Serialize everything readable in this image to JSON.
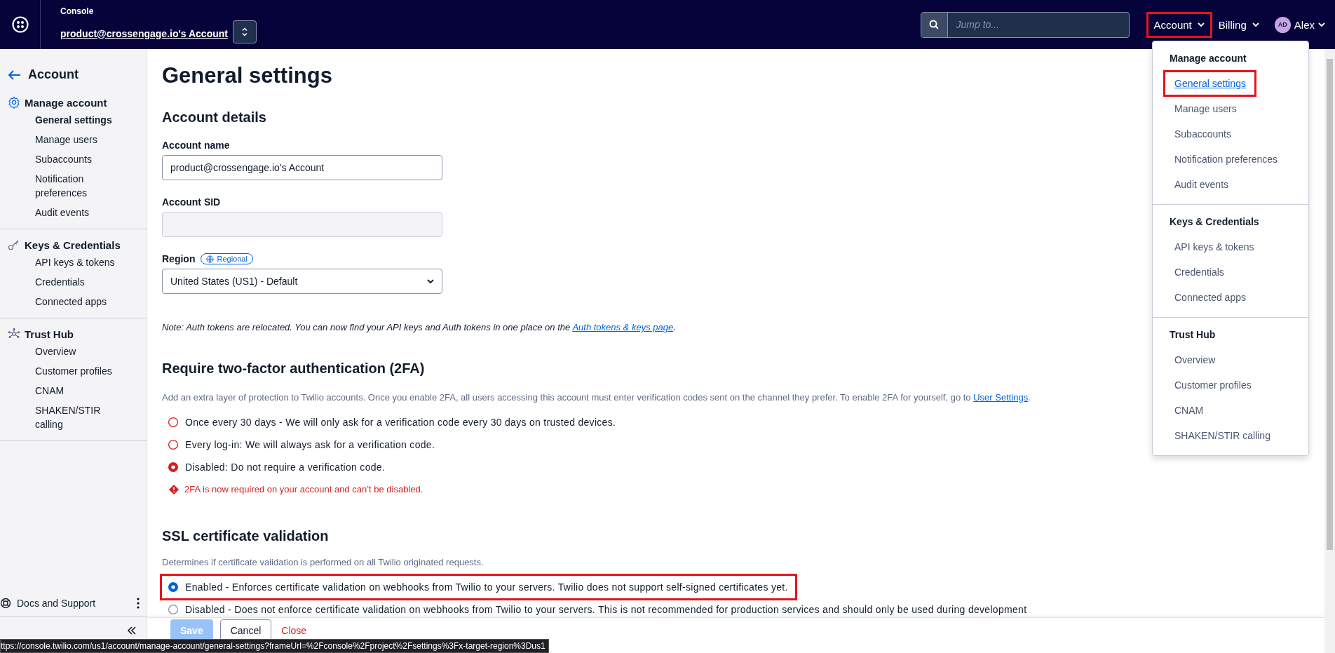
{
  "topbar": {
    "product": "Console",
    "account_name": "product@crossengage.io's Account",
    "search": {
      "placeholder": "Jump to..."
    },
    "nav": [
      {
        "label": "Account",
        "highlighted": true
      },
      {
        "label": "Billing",
        "highlighted": false
      }
    ],
    "user": {
      "initials": "AD",
      "name": "Alex"
    }
  },
  "sidebar": {
    "back_label": "Account",
    "sections": [
      {
        "kind": "gear",
        "title": "Manage account",
        "items": [
          {
            "label": "General settings",
            "selected": true
          },
          {
            "label": "Manage users",
            "selected": false
          },
          {
            "label": "Subaccounts",
            "selected": false
          },
          {
            "label": "Notification preferences",
            "selected": false
          },
          {
            "label": "Audit events",
            "selected": false
          }
        ]
      },
      {
        "kind": "key",
        "title": "Keys & Credentials",
        "items": [
          {
            "label": "API keys & tokens",
            "selected": false
          },
          {
            "label": "Credentials",
            "selected": false
          },
          {
            "label": "Connected apps",
            "selected": false
          }
        ]
      },
      {
        "kind": "hub",
        "title": "Trust Hub",
        "items": [
          {
            "label": "Overview",
            "selected": false
          },
          {
            "label": "Customer profiles",
            "selected": false
          },
          {
            "label": "CNAM",
            "selected": false
          },
          {
            "label": "SHAKEN/STIR calling",
            "selected": false
          }
        ]
      }
    ],
    "docs_label": "Docs and Support"
  },
  "page": {
    "title": "General settings",
    "account_details": {
      "heading": "Account details",
      "name_label": "Account name",
      "name_value": "product@crossengage.io's Account",
      "sid_label": "Account SID",
      "region_label": "Region",
      "region_badge": "Regional",
      "region_value": "United States (US1) - Default",
      "note": "Note: Auth tokens are relocated. You can now find your API keys and Auth tokens in one place on the ",
      "note_link": "Auth tokens & keys page",
      "note_end": "."
    },
    "two_factor": {
      "heading": "Require two-factor authentication (2FA)",
      "description": "Add an extra layer of protection to Twilio accounts. Once you enable 2FA, all users accessing this account must enter verification codes sent on the channel they prefer. To enable 2FA for yourself, go to ",
      "link": "User Settings",
      "description_end": ".",
      "options": [
        {
          "label": "Once every 30 days - We will only ask for a verification code every 30 days on trusted devices.",
          "selected": false
        },
        {
          "label": "Every log-in: We will always ask for a verification code.",
          "selected": false
        },
        {
          "label": "Disabled: Do not require a verification code.",
          "selected": true
        }
      ],
      "error": "2FA is now required on your account and can’t be disabled."
    },
    "ssl": {
      "heading": "SSL certificate validation",
      "description": "Determines if certificate validation is performed on all Twilio originated requests.",
      "options": [
        {
          "label": "Enabled - Enforces certificate validation on webhooks from Twilio to your servers. Twilio does not support self-signed certificates yet.",
          "selected": true,
          "highlighted": true
        },
        {
          "label": "Disabled - Does not enforce certificate validation on webhooks from Twilio to your servers. This is not recommended for production services and should only be used during development",
          "selected": false,
          "highlighted": false
        }
      ]
    }
  },
  "footer": {
    "buttons": [
      {
        "label": "Save",
        "kind": "primary",
        "disabled": true
      },
      {
        "label": "Cancel",
        "kind": "secondary",
        "disabled": false
      },
      {
        "label": "Close",
        "kind": "link",
        "disabled": false
      }
    ]
  },
  "menu": {
    "sections": [
      {
        "title": "Manage account",
        "items": [
          {
            "label": "General settings",
            "selected": true,
            "highlighted": true
          },
          {
            "label": "Manage users",
            "selected": false,
            "highlighted": false
          },
          {
            "label": "Subaccounts",
            "selected": false,
            "highlighted": false
          },
          {
            "label": "Notification preferences",
            "selected": false,
            "highlighted": false
          },
          {
            "label": "Audit events",
            "selected": false,
            "highlighted": false
          }
        ]
      },
      {
        "title": "Keys & Credentials",
        "items": [
          {
            "label": "API keys & tokens",
            "selected": false,
            "highlighted": false
          },
          {
            "label": "Credentials",
            "selected": false,
            "highlighted": false
          },
          {
            "label": "Connected apps",
            "selected": false,
            "highlighted": false
          }
        ]
      },
      {
        "title": "Trust Hub",
        "items": [
          {
            "label": "Overview",
            "selected": false,
            "highlighted": false
          },
          {
            "label": "Customer profiles",
            "selected": false,
            "highlighted": false
          },
          {
            "label": "CNAM",
            "selected": false,
            "highlighted": false
          },
          {
            "label": "SHAKEN/STIR calling",
            "selected": false,
            "highlighted": false
          }
        ]
      }
    ]
  },
  "status_url": "ttps://console.twilio.com/us1/account/manage-account/general-settings?frameUrl=%2Fconsole%2Fproject%2Fsettings%3Fx-target-region%3Dus1"
}
